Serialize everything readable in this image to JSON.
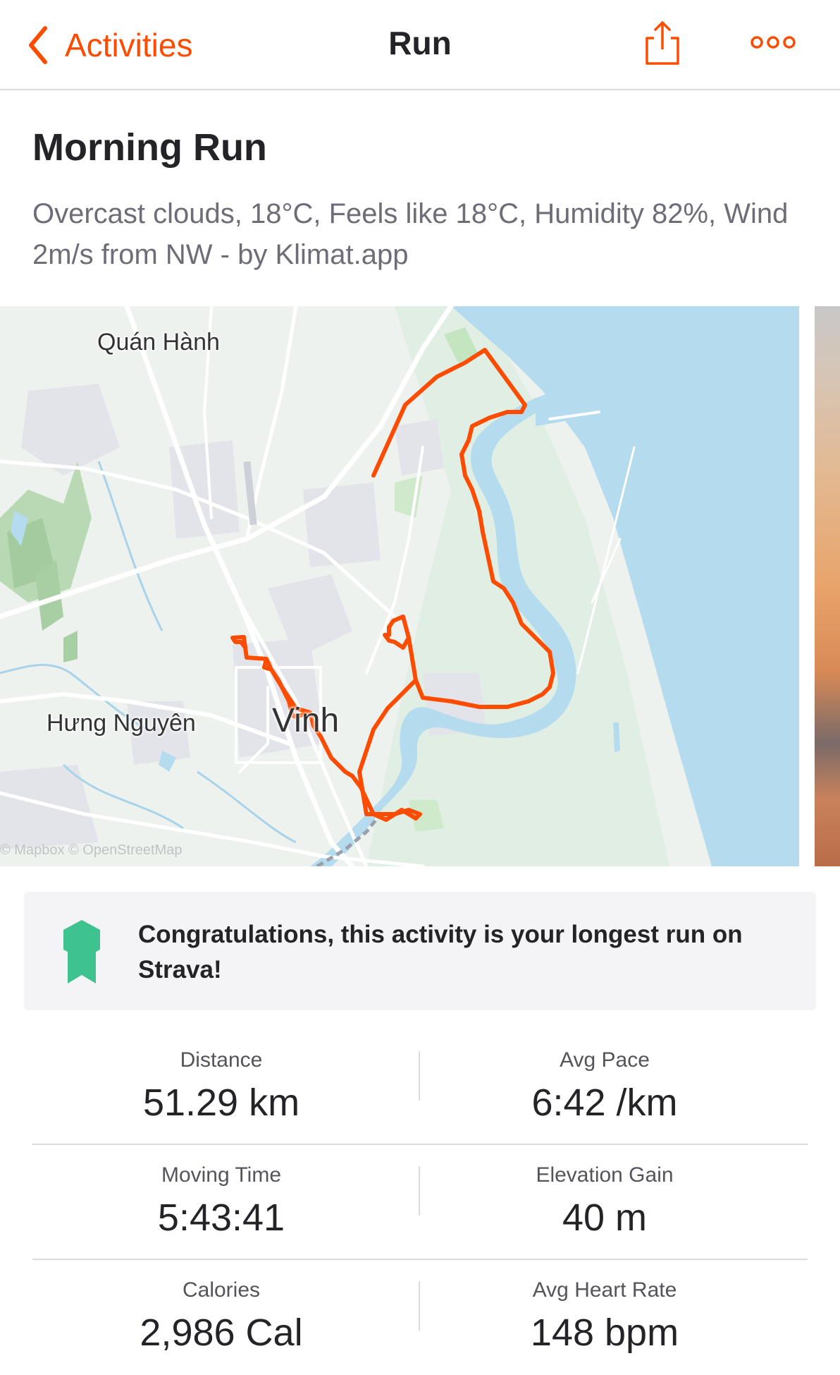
{
  "nav": {
    "back_label": "Activities",
    "title": "Run",
    "accent_color": "#fc4c02"
  },
  "activity": {
    "title": "Morning Run",
    "description": "Overcast clouds, 18°C, Feels like 18°C, Humidity 82%, Wind 2m/s from NW - by Klimat.app"
  },
  "map": {
    "labels": {
      "quan_hanh": "Quán Hành",
      "hung_nguyen": "Hưng Nguyên",
      "vinh": "Vinh"
    },
    "attribution": "© Mapbox © OpenStreetMap",
    "route_color": "#fc4c02",
    "water_color": "#b4dcee"
  },
  "achievement": {
    "text": "Congratulations, this activity is your longest run on Strava!",
    "icon": "medal-icon",
    "icon_color": "#3ec28f"
  },
  "stats": [
    {
      "left": {
        "label": "Distance",
        "value": "51.29 km"
      },
      "right": {
        "label": "Avg Pace",
        "value": "6:42 /km"
      }
    },
    {
      "left": {
        "label": "Moving Time",
        "value": "5:43:41"
      },
      "right": {
        "label": "Elevation Gain",
        "value": "40 m"
      }
    },
    {
      "left": {
        "label": "Calories",
        "value": "2,986 Cal"
      },
      "right": {
        "label": "Avg Heart Rate",
        "value": "148 bpm"
      }
    }
  ]
}
